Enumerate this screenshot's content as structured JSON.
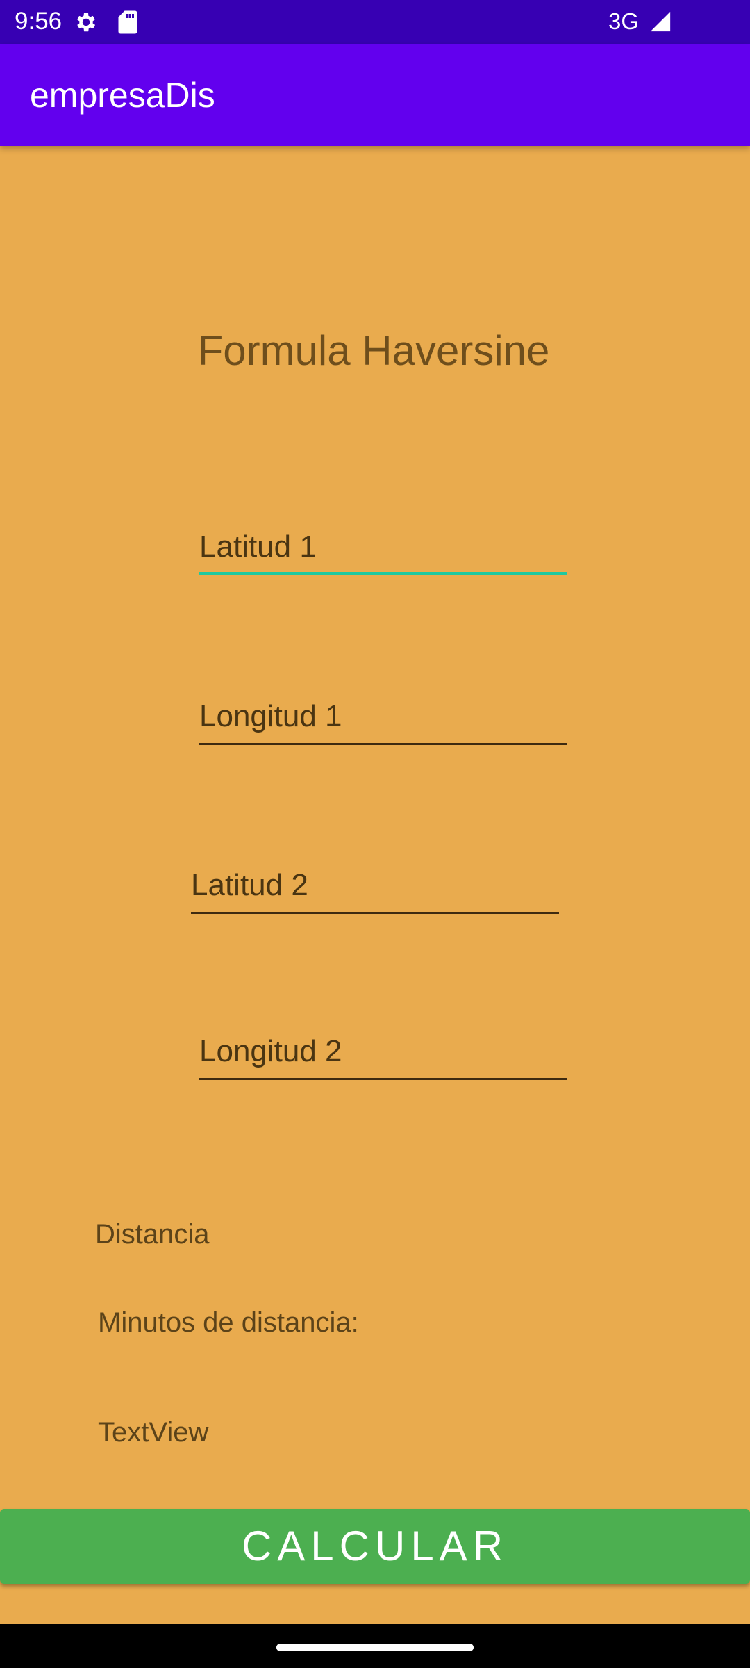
{
  "status_bar": {
    "time": "9:56",
    "network": "3G",
    "icons": [
      "gear-icon",
      "sd-card-icon",
      "signal-icon"
    ],
    "background": "#3700B3"
  },
  "app_bar": {
    "title": "empresaDis",
    "background": "#6200EE"
  },
  "main": {
    "background": "#E9AB4E",
    "heading": "Formula Haversine",
    "fields": {
      "lat1_placeholder": "Latitud 1",
      "lon1_placeholder": "Longitud 1",
      "lat2_placeholder": "Latitud 2",
      "lon2_placeholder": "Longitud 2"
    },
    "distance_label": "Distancia",
    "minutes_label": "Minutos de distancia:",
    "result_text": "TextView",
    "calculate_button": "CALCULAR",
    "button_color": "#4CAF50",
    "focus_color": "#1EC9A0"
  }
}
